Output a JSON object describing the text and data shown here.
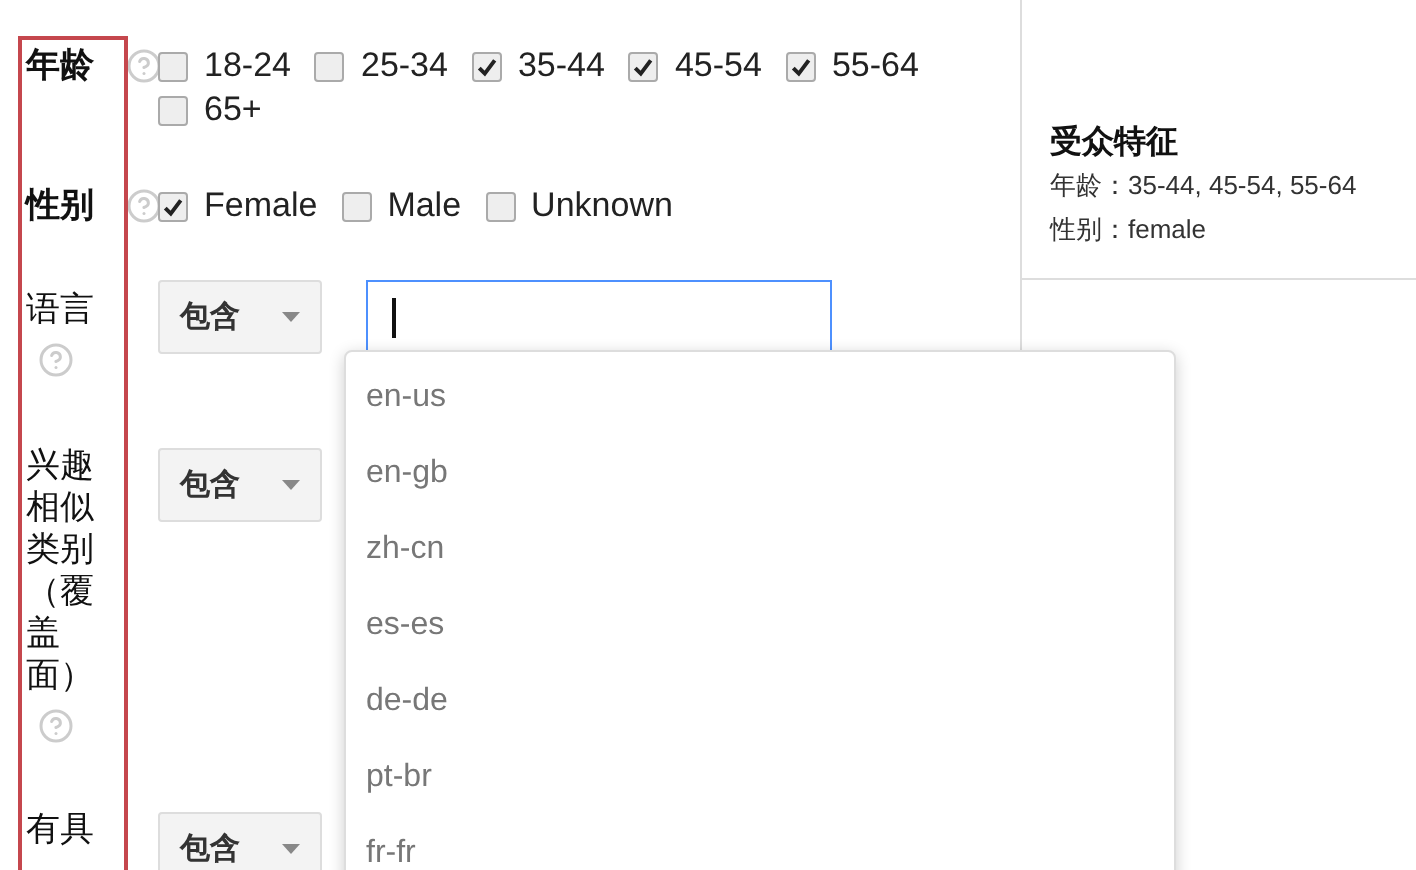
{
  "targeting": [
    {
      "kind": "checkboxes",
      "label": "年龄",
      "emphasized": true,
      "options": [
        {
          "label": "18-24",
          "checked": false
        },
        {
          "label": "25-34",
          "checked": false
        },
        {
          "label": "35-44",
          "checked": true
        },
        {
          "label": "45-54",
          "checked": true
        },
        {
          "label": "55-64",
          "checked": true
        },
        {
          "label": "65+",
          "checked": false
        }
      ]
    },
    {
      "kind": "checkboxes",
      "label": "性别",
      "emphasized": true,
      "options": [
        {
          "label": "Female",
          "checked": true
        },
        {
          "label": "Male",
          "checked": false
        },
        {
          "label": "Unknown",
          "checked": false
        }
      ]
    },
    {
      "kind": "select_field",
      "label": "语言",
      "emphasized": false,
      "operator": "包含",
      "field": {
        "focused": true
      },
      "suggestions": [
        "en-us",
        "en-gb",
        "zh-cn",
        "es-es",
        "de-de",
        "pt-br",
        "fr-fr"
      ]
    },
    {
      "kind": "select",
      "label": "兴趣相似类别（覆盖面）",
      "emphasized": false,
      "operator": "包含"
    },
    {
      "kind": "select",
      "label": "有具",
      "emphasized": false,
      "operator": "包含"
    }
  ],
  "summary": {
    "title": "受众特征",
    "lines": [
      "年龄：35-44, 45-54, 55-64",
      "性别：female"
    ]
  }
}
